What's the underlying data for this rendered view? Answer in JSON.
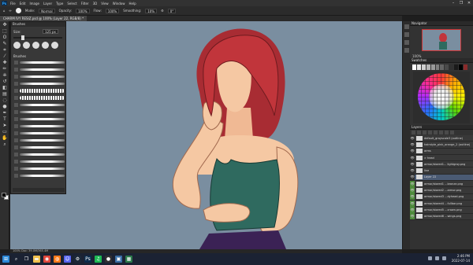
{
  "app": {
    "logo": "Ps",
    "menu": [
      "File",
      "Edit",
      "Image",
      "Layer",
      "Type",
      "Select",
      "Filter",
      "3D",
      "View",
      "Window",
      "Help"
    ],
    "window_controls": [
      "–",
      "❐",
      "✕"
    ]
  },
  "options_bar": {
    "mode_label": "Mode:",
    "mode_value": "Normal",
    "opacity_label": "Opacity:",
    "opacity_value": "100%",
    "flow_label": "Flow:",
    "flow_value": "100%",
    "smoothing_label": "Smoothing:",
    "smoothing_value": "10%",
    "angle_value": "0°"
  },
  "document_tab": {
    "title": "CHARM IVY RESIZ.psd @ 100% (Layer 22, RGB/8) *"
  },
  "toolbar": {
    "tools": [
      "move-icon",
      "marquee-icon",
      "lasso-icon",
      "quick-select-icon",
      "crop-icon",
      "eyedropper-icon",
      "healing-icon",
      "brush-icon",
      "stamp-icon",
      "history-brush-icon",
      "eraser-icon",
      "gradient-icon",
      "blur-icon",
      "dodge-icon",
      "pen-icon",
      "type-icon",
      "path-select-icon",
      "shape-icon",
      "hand-icon",
      "zoom-icon"
    ],
    "tool_glyphs": [
      "✥",
      "⬚",
      "ʘ",
      "✎",
      "⌗",
      "⁄",
      "✚",
      "✏",
      "⎈",
      "↺",
      "◧",
      "▤",
      "◌",
      "●",
      "✒",
      "T",
      "➤",
      "▭",
      "✋",
      "⌕"
    ],
    "foreground_color": "#000000",
    "background_color": "#ffffff"
  },
  "brush_panel": {
    "title": "Brushes",
    "size_label": "Size:",
    "size_value": "125 px",
    "folder_label": "Brushes",
    "stroke_styles": [
      "soft",
      "soft",
      "soft",
      "soft",
      "rough",
      "rough",
      "soft",
      "soft",
      "soft",
      "soft",
      "soft",
      "soft",
      "soft",
      "soft",
      "soft",
      "soft",
      "soft"
    ]
  },
  "navigator": {
    "title": "Navigator",
    "zoom": "100%"
  },
  "swatches": {
    "title": "Swatches",
    "colors": [
      "#ffffff",
      "#e8e8e8",
      "#cfcfcf",
      "#b5b5b5",
      "#9a9a9a",
      "#7f7f7f",
      "#656565",
      "#4a4a4a",
      "#303030",
      "#1a1a1a",
      "#000000",
      "#8a2b2b"
    ]
  },
  "layers_panel": {
    "title": "Layers",
    "layers": [
      {
        "name": "default_grayscale3 (outline)",
        "selected": false,
        "green": false
      },
      {
        "name": "hairstyle_pink_orange_2 (outline)",
        "selected": false,
        "green": false
      },
      {
        "name": "arms",
        "selected": false,
        "green": false
      },
      {
        "name": "> head",
        "selected": false,
        "green": false
      },
      {
        "name": "armor/stored1... lightgray.png",
        "selected": false,
        "green": false
      },
      {
        "name": "line",
        "selected": false,
        "green": false
      },
      {
        "name": "Layer 22",
        "selected": true,
        "green": false
      },
      {
        "name": "armor/stored1 ...bronze.png",
        "selected": false,
        "green": true
      },
      {
        "name": "armor/stored2 ...armor.png",
        "selected": false,
        "green": true
      },
      {
        "name": "armor/stored3 ...dyhead.png",
        "selected": false,
        "green": true
      },
      {
        "name": "armor/stored4 ...fullbar.png",
        "selected": false,
        "green": true
      },
      {
        "name": "armor/stored5 ...crown.png",
        "selected": false,
        "green": true
      },
      {
        "name": "armor/stored6 ...wings.png",
        "selected": false,
        "green": true
      }
    ]
  },
  "status_bar": {
    "text": "100%   Doc: 39.0M/365.4M"
  },
  "taskbar": {
    "time": "2:46 PM",
    "date": "2022-07-14",
    "apps": [
      {
        "icon": "windows-icon",
        "color": "#2b88d8",
        "glyph": "⊞"
      },
      {
        "icon": "search-icon",
        "color": "#1b2233",
        "glyph": "⌕"
      },
      {
        "icon": "taskview-icon",
        "color": "#1b2233",
        "glyph": "❐"
      },
      {
        "icon": "explorer-icon",
        "color": "#f2c14e",
        "glyph": "▬"
      },
      {
        "icon": "chrome-icon",
        "color": "#e0453a",
        "glyph": "◉"
      },
      {
        "icon": "firefox-icon",
        "color": "#ff7a1a",
        "glyph": "◍"
      },
      {
        "icon": "discord-icon",
        "color": "#5865f2",
        "glyph": "☺"
      },
      {
        "icon": "steam-icon",
        "color": "#1b2838",
        "glyph": "⚙"
      },
      {
        "icon": "photoshop-icon",
        "color": "#0b2a4a",
        "glyph": "Ps"
      },
      {
        "icon": "spotify-icon",
        "color": "#1db954",
        "glyph": "♫"
      },
      {
        "icon": "obs-icon",
        "color": "#302e31",
        "glyph": "●"
      },
      {
        "icon": "app-icon",
        "color": "#3a6ea5",
        "glyph": "▣"
      },
      {
        "icon": "app2-icon",
        "color": "#2c7a4b",
        "glyph": "▦"
      }
    ]
  },
  "canvas": {
    "background": "#7a8ea0",
    "hair_color": "#c1353b",
    "skin_color": "#f5c8a3",
    "top_color": "#2f6a5f",
    "skirt_color": "#3b2255"
  }
}
